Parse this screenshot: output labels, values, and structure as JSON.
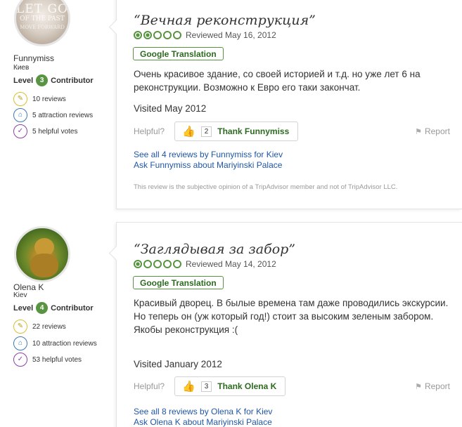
{
  "reviews": [
    {
      "member": {
        "avatar_text": [
          "LET GO",
          "OF THE PAST",
          "MOVE FORWARD"
        ],
        "name": "Funnymiss",
        "location": "Киев",
        "level_prefix": "Level",
        "level": "3",
        "level_suffix": "Contributor",
        "stats": {
          "reviews": "10 reviews",
          "attraction_reviews": "5 attraction reviews",
          "helpful_votes": "5 helpful votes"
        }
      },
      "title": "“Вечная реконструкция”",
      "rating": 2,
      "reviewed": "Reviewed May 16, 2012",
      "translation_badge": "Google Translation",
      "body": "Очень красивое здание, со своей историей и т.д. но уже лет 6 на реконструкции. Возможно к Евро его таки закончат.",
      "visited": "Visited May 2012",
      "helpful_label": "Helpful?",
      "thank_count": "2",
      "thank_label": "Thank Funnymiss",
      "report_label": "Report",
      "link_see_all": "See all 4 reviews by Funnymiss for Kiev",
      "link_ask": "Ask Funnymiss about Mariyinski Palace",
      "disclaimer": "This review is the subjective opinion of a TripAdvisor member and not of TripAdvisor LLC."
    },
    {
      "member": {
        "name": "Olena K",
        "location": "Kiev",
        "level_prefix": "Level",
        "level": "4",
        "level_suffix": "Contributor",
        "stats": {
          "reviews": "22 reviews",
          "attraction_reviews": "10 attraction reviews",
          "helpful_votes": "53 helpful votes"
        }
      },
      "title": "“Заглядывая за забор”",
      "rating": 1,
      "reviewed": "Reviewed May 14, 2012",
      "translation_badge": "Google Translation",
      "body_lines": [
        "Красивый дворец. В былые времена там даже проводились экскурсии.",
        "Но теперь он (уж который год!) стоит за высоким зеленым забором.",
        "Якобы реконструкция :("
      ],
      "visited": "Visited January 2012",
      "helpful_label": "Helpful?",
      "thank_count": "3",
      "thank_label": "Thank Olena K",
      "report_label": "Report",
      "link_see_all": "See all 8 reviews by Olena K for Kiev",
      "link_ask": "Ask Olena K about Mariyinski Palace"
    }
  ],
  "colors": {
    "accent_green": "#589442",
    "link_blue": "#1f56a6"
  }
}
